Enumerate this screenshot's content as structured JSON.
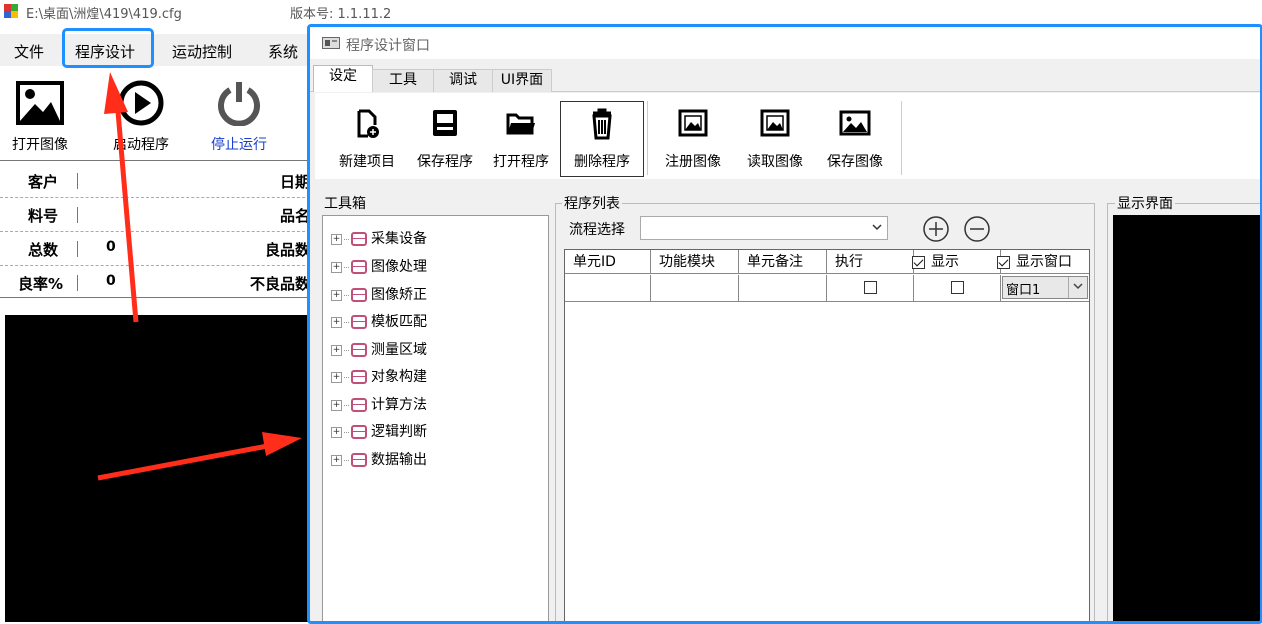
{
  "window": {
    "path": "E:\\桌面\\洲煌\\419\\419.cfg",
    "version": "版本号: 1.1.11.2"
  },
  "menu": {
    "items": [
      "文件",
      "程序设计",
      "运动控制",
      "系统"
    ]
  },
  "toolbar": {
    "open_image": "打开图像",
    "start_program": "启动程序",
    "stop_run": "停止运行"
  },
  "info": {
    "rows": [
      {
        "key": "客户",
        "value": "",
        "right": "日期"
      },
      {
        "key": "料号",
        "value": "",
        "right": "品名"
      },
      {
        "key": "总数",
        "value": "0",
        "right": "良品数"
      },
      {
        "key": "良率%",
        "value": "0",
        "right": "不良品数"
      }
    ]
  },
  "dialog": {
    "title": "程序设计窗口",
    "tabs": [
      "设定",
      "工具",
      "调试",
      "UI界面"
    ],
    "ribbon": [
      "新建项目",
      "保存程序",
      "打开程序",
      "删除程序",
      "注册图像",
      "读取图像",
      "保存图像"
    ],
    "toolbox": {
      "title": "工具箱",
      "nodes": [
        "采集设备",
        "图像处理",
        "图像矫正",
        "模板匹配",
        "测量区域",
        "对象构建",
        "计算方法",
        "逻辑判断",
        "数据输出"
      ]
    },
    "program_list": {
      "title": "程序列表",
      "flow_label": "流程选择",
      "flow_value": "",
      "columns": [
        "单元ID",
        "功能模块",
        "单元备注",
        "执行",
        "显示",
        "显示窗口"
      ],
      "row": {
        "window_value": "窗口1"
      }
    },
    "display": {
      "title": "显示界面"
    }
  },
  "colors": {
    "highlight": "#1e90ff",
    "arrow": "#ff2d1a",
    "db_icon": "#c0507a"
  }
}
